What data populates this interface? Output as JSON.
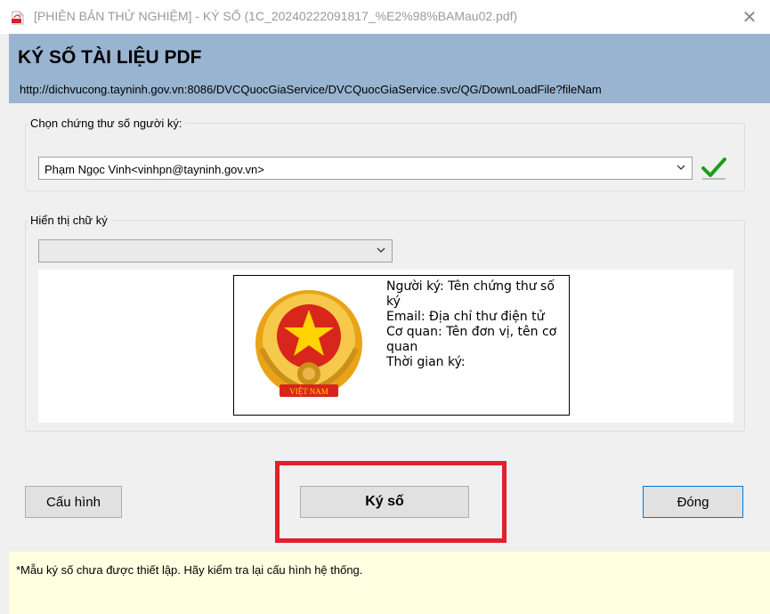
{
  "window": {
    "title": "[PHIÊN BẢN THỬ NGHIỆM] - KÝ SỐ (1C_20240222091817_%E2%98%BAMau02.pdf)",
    "close_label": "✕"
  },
  "header": {
    "title": "KÝ SỐ TÀI LIỆU PDF",
    "url": "http://dichvucong.tayninh.gov.vn:8086/DVCQuocGiaService/DVCQuocGiaService.svc/QG/DownLoadFile?fileNam"
  },
  "certificate": {
    "legend": "Chọn chứng thư số người ký:",
    "selected": "Phạm Ngọc Vinh<vinhpn@tayninh.gov.vn>",
    "verified_color": "#1a9e1a"
  },
  "signature_display": {
    "legend": "Hiển thị chữ ký",
    "selected": "",
    "preview_lines": [
      "Người ký: Tên chứng thư số ký",
      "Email: Địa chỉ thư điện tử",
      "Cơ quan: Tên đơn vị, tên cơ quan",
      "Thời gian ký:"
    ],
    "emblem_text": "VIỆT NAM"
  },
  "buttons": {
    "config": "Cấu hình",
    "sign": "Ký số",
    "close": "Đóng"
  },
  "status": {
    "message": "*Mẫu ký số chưa được thiết lập. Hãy kiểm tra lại cấu hình hệ thống."
  },
  "colors": {
    "header_bg": "#99b4d1",
    "highlight": "#e3202d",
    "status_bg": "#ffffe1"
  }
}
